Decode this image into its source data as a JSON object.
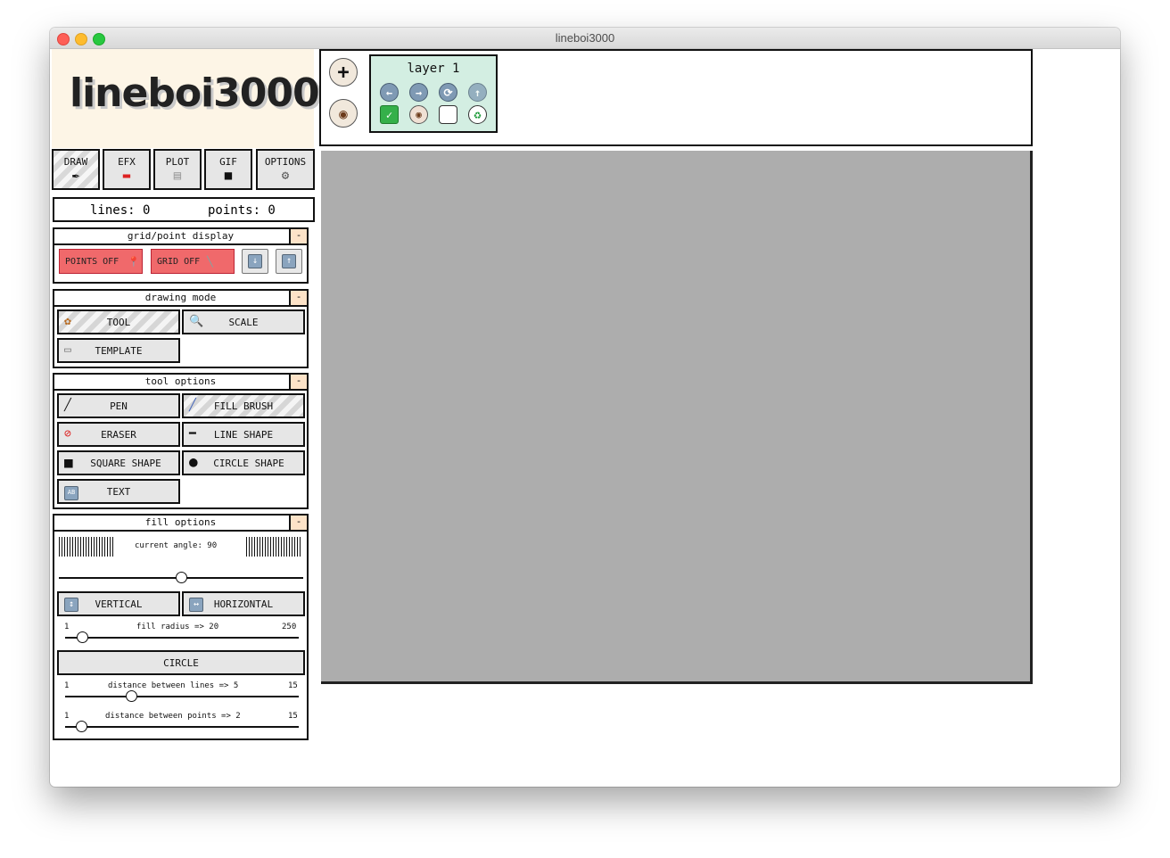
{
  "window": {
    "title": "lineboi3000"
  },
  "logo": {
    "text": "lineboi3000"
  },
  "tabs": [
    {
      "label": "DRAW",
      "icon": "pen-icon",
      "active": true
    },
    {
      "label": "EFX",
      "icon": "toolbox-icon"
    },
    {
      "label": "PLOT",
      "icon": "paper-icon"
    },
    {
      "label": "GIF",
      "icon": "video-camera-icon"
    },
    {
      "label": "OPTIONS",
      "icon": "gear-icon"
    }
  ],
  "stats": {
    "lines": "lines: 0",
    "points": "points: 0"
  },
  "grid_panel": {
    "title": "grid/point display",
    "minimize": "-",
    "points_toggle": "POINTS OFF",
    "grid_toggle": "GRID OFF"
  },
  "drawing_mode": {
    "title": "drawing mode",
    "minimize": "-",
    "tool": "TOOL",
    "scale": "SCALE",
    "template": "TEMPLATE"
  },
  "tool_options": {
    "title": "tool options",
    "minimize": "-",
    "pen": "PEN",
    "fill_brush": "FILL BRUSH",
    "eraser": "ERASER",
    "line_shape": "LINE SHAPE",
    "square_shape": "SQUARE SHAPE",
    "circle_shape": "CIRCLE SHAPE",
    "text": "TEXT"
  },
  "fill_options": {
    "title": "fill options",
    "minimize": "-",
    "current_angle": "current angle: 90",
    "angle_fraction": 0.5,
    "vertical": "VERTICAL",
    "horizontal": "HORIZONTAL",
    "fill_radius": {
      "label": "fill radius => 20",
      "min": "1",
      "max": "250",
      "value": 20
    },
    "circle": "CIRCLE",
    "line_distance": {
      "label": "distance between lines => 5",
      "min": "1",
      "max": "15",
      "value": 5
    },
    "point_distance": {
      "label": "distance between points => 2",
      "min": "1",
      "max": "15",
      "value": 2
    }
  },
  "layers": {
    "add_icon": "plus-icon",
    "visibility_icon": "eye-icon",
    "items": [
      {
        "name": "layer 1"
      }
    ]
  },
  "colors": {
    "logo_bg": "#fdf5e6",
    "layer_card_bg": "#d3eee2",
    "toggle_off_red": "#f0696b",
    "canvas_bg": "#adadad"
  }
}
